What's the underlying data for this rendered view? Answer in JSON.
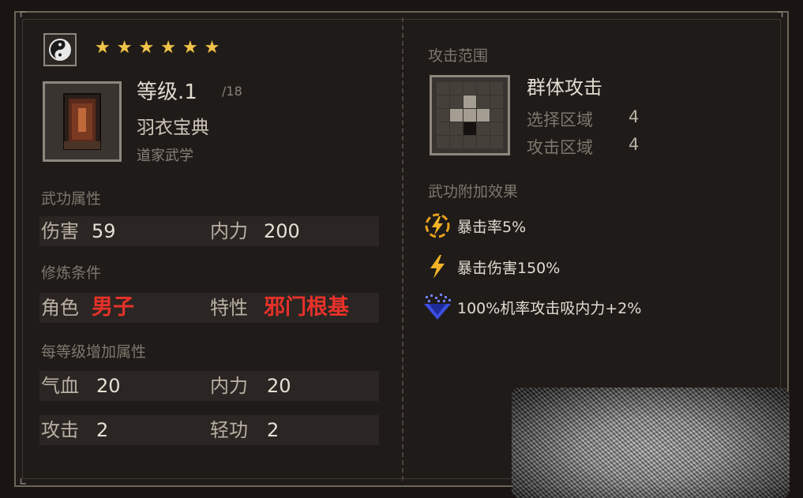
{
  "header": {
    "stars": [
      "★",
      "★",
      "★",
      "★",
      "★",
      "★"
    ],
    "level_label": "等级.1",
    "level_max": "/18",
    "book_name": "羽衣宝典",
    "book_school": "道家武学"
  },
  "attributes": {
    "title": "武功属性",
    "damage_label": "伤害",
    "damage_value": "59",
    "neili_label": "内力",
    "neili_value": "200"
  },
  "requirements": {
    "title": "修炼条件",
    "role_label": "角色",
    "role_value": "男子",
    "trait_label": "特性",
    "trait_value": "邪门根基"
  },
  "per_level": {
    "title": "每等级增加属性",
    "qixue_label": "气血",
    "qixue_value": "20",
    "neili_label": "内力",
    "neili_value": "20",
    "attack_label": "攻击",
    "attack_value": "2",
    "qinggong_label": "轻功",
    "qinggong_value": "2"
  },
  "range": {
    "title": "攻击范围",
    "attack_type": "群体攻击",
    "select_label": "选择区域",
    "select_value": "4",
    "area_label": "攻击区域",
    "area_value": "4"
  },
  "effects": {
    "title": "武功附加效果",
    "items": [
      {
        "icon": "lightning-circle-icon",
        "text": "暴击率5%"
      },
      {
        "icon": "lightning-icon",
        "text": "暴击伤害150%"
      },
      {
        "icon": "blue-crystal-icon",
        "text": "100%机率攻击吸内力+2%"
      }
    ]
  },
  "colors": {
    "star": "#f0c34a",
    "requirement_red": "#e8312a",
    "effect_gold": "#e8a21a",
    "effect_blue": "#3a4ee0"
  }
}
